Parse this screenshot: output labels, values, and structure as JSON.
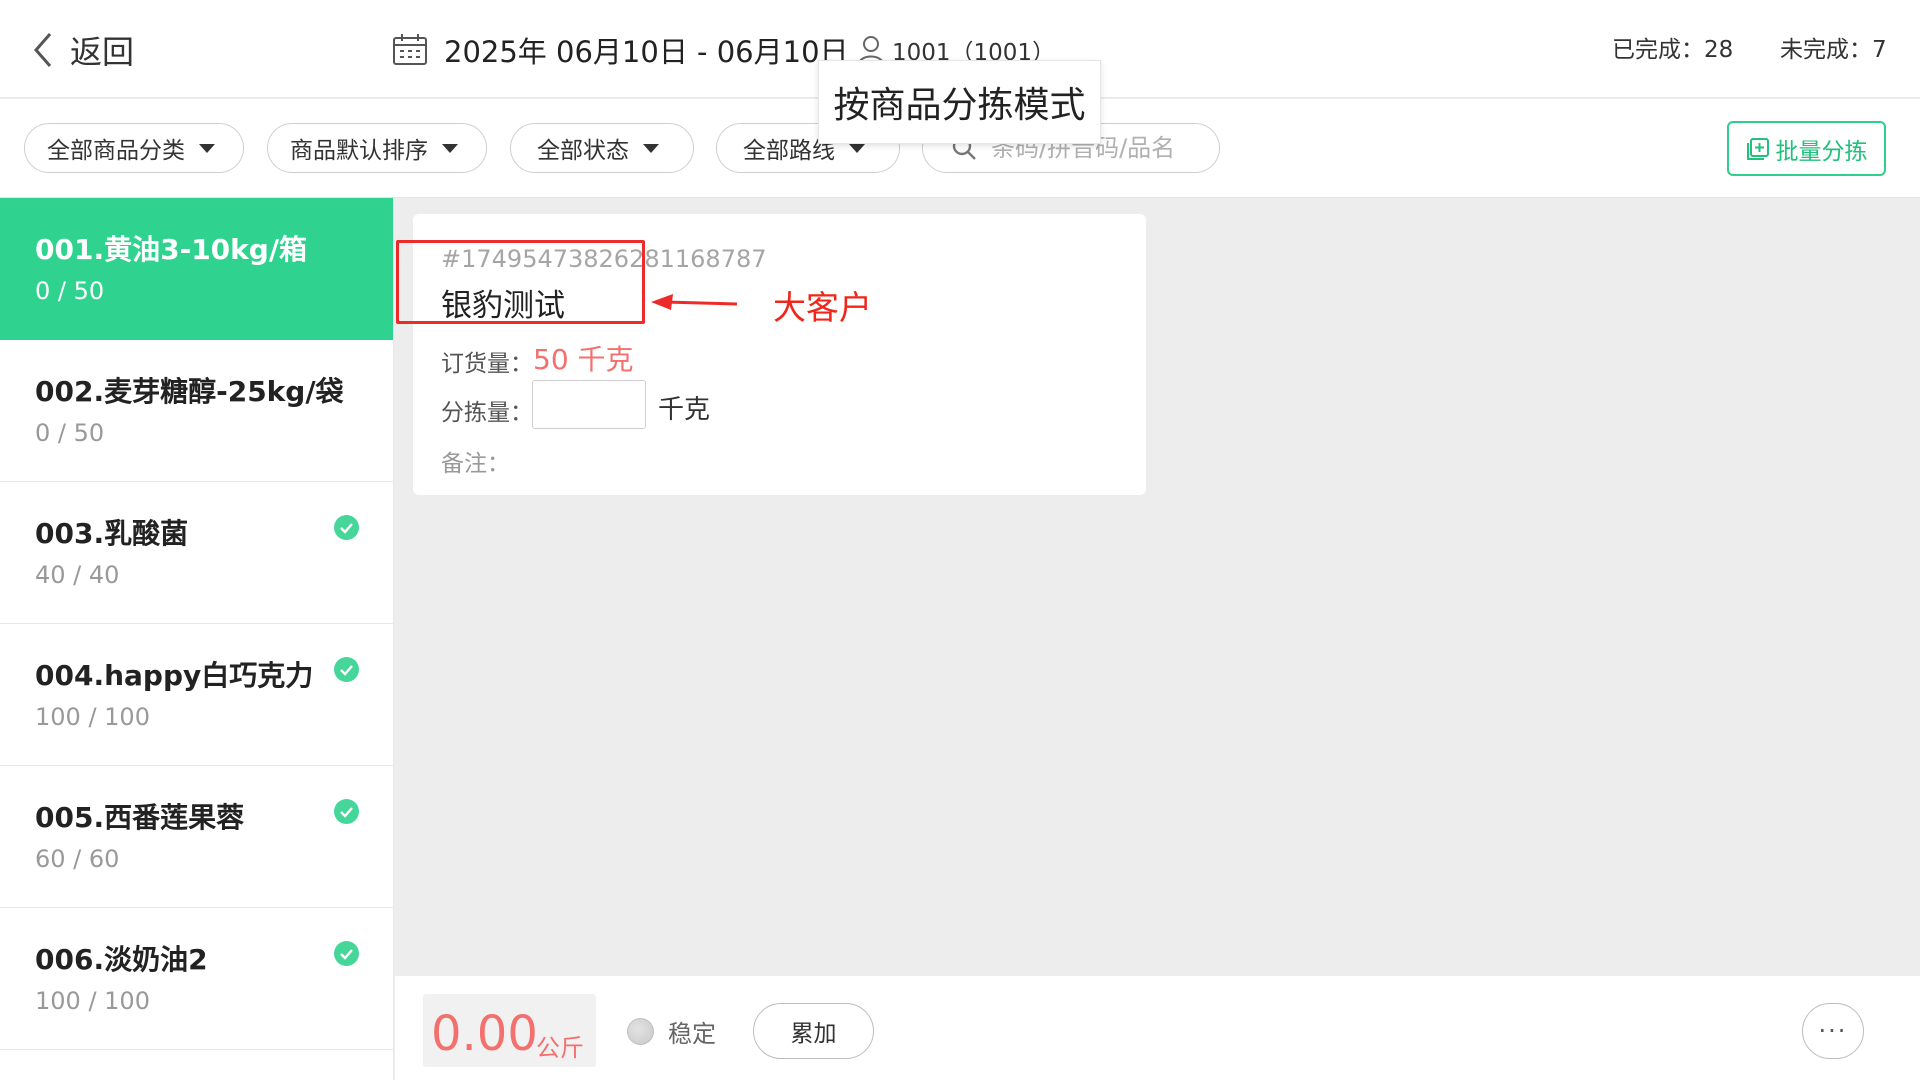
{
  "header": {
    "back_label": "返回",
    "date_range": "2025年 06月10日 - 06月10日",
    "user": "1001（1001）",
    "completed": "已完成：28",
    "uncompleted": "未完成：7"
  },
  "tooltip": "按商品分拣模式",
  "filters": {
    "category": "全部商品分类",
    "sort": "商品默认排序",
    "status": "全部状态",
    "route": "全部路线",
    "search_placeholder": "条码/拼音码/品名",
    "batch_label": "批量分拣"
  },
  "products": [
    {
      "name": "001.黄油3-10kg/箱",
      "count": "0 / 50",
      "done": false,
      "active": true
    },
    {
      "name": "002.麦芽糖醇-25kg/袋",
      "count": "0 / 50",
      "done": false,
      "active": false
    },
    {
      "name": "003.乳酸菌",
      "count": "40 / 40",
      "done": true,
      "active": false
    },
    {
      "name": "004.happy白巧克力",
      "count": "100 / 100",
      "done": true,
      "active": false
    },
    {
      "name": "005.西番莲果蓉",
      "count": "60 / 60",
      "done": true,
      "active": false
    },
    {
      "name": "006.淡奶油2",
      "count": "100 / 100",
      "done": true,
      "active": false
    }
  ],
  "order_card": {
    "order_no": "#17495473826281168787",
    "customer": "银豹测试",
    "order_qty_label": "订货量：",
    "order_qty_value": "50 千克",
    "sort_qty_label": "分拣量：",
    "sort_qty_value": "",
    "sort_qty_unit": "千克",
    "remark_label": "备注："
  },
  "annotation": {
    "text": "大客户"
  },
  "bottom": {
    "weight": "0.00",
    "weight_unit": "公斤",
    "stable_label": "稳定",
    "accumulate_label": "累加",
    "more_label": "···"
  },
  "colors": {
    "accent": "#2fd38f",
    "accent_text": "#21c07c",
    "qty_red": "#f2716e",
    "annotation_red": "#ec2b2b"
  }
}
